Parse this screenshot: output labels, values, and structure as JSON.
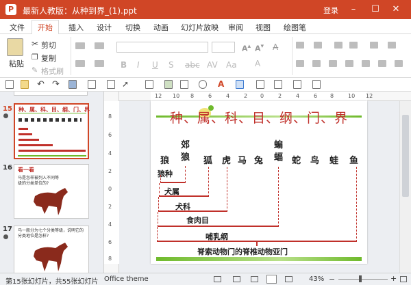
{
  "window": {
    "title": "最新人教版：从种到界_(1).ppt",
    "login": "登录",
    "app_logo": "P"
  },
  "tabs": [
    {
      "label": "文件"
    },
    {
      "label": "开始"
    },
    {
      "label": "插入"
    },
    {
      "label": "设计"
    },
    {
      "label": "切换"
    },
    {
      "label": "动画"
    },
    {
      "label": "幻灯片放映"
    },
    {
      "label": "审阅"
    },
    {
      "label": "视图"
    },
    {
      "label": "绘图笔"
    }
  ],
  "ribbon": {
    "paste": "粘贴",
    "cut": "剪切",
    "copy": "复制",
    "format_painter": "格式刷"
  },
  "slides": [
    {
      "number": "15",
      "title": "种、属、科、目、纲、门、界"
    },
    {
      "number": "16",
      "title": "看一看",
      "text": "马是怎样被列入不同等级的分类单位的?"
    },
    {
      "number": "17",
      "text": "马一般分为七个分类等级，说明它的分类地位是怎样?"
    }
  ],
  "main_slide": {
    "title": "种、属、科、目、纲、门、界",
    "animals": [
      {
        "name": "狼"
      },
      {
        "name": "郊狼"
      },
      {
        "name": "狐"
      },
      {
        "name": "虎"
      },
      {
        "name": "马"
      },
      {
        "name": "兔"
      },
      {
        "name": "蝙蝠"
      },
      {
        "name": "蛇"
      },
      {
        "name": "鸟"
      },
      {
        "name": "蛙"
      },
      {
        "name": "鱼"
      }
    ],
    "levels": {
      "species": "狼种",
      "genus": "犬属",
      "family": "犬科",
      "order": "食肉目",
      "class": "哺乳纲",
      "phylum": "脊索动物门的脊椎动物亚门"
    }
  },
  "hruler_ticks": [
    "12",
    "10",
    "8",
    "6",
    "4",
    "2",
    "0",
    "2",
    "4",
    "6",
    "8",
    "10",
    "12"
  ],
  "vruler_ticks": [
    "8",
    "6",
    "4",
    "2",
    "0",
    "2",
    "4",
    "6",
    "8"
  ],
  "status": {
    "slide_info": "第15张幻灯片，共55张幻灯片",
    "theme": "Office theme",
    "zoom": "43%"
  },
  "colors": {
    "accent": "#d04626",
    "slide_red": "#c0302a",
    "slide_green": "#6fba2c"
  }
}
